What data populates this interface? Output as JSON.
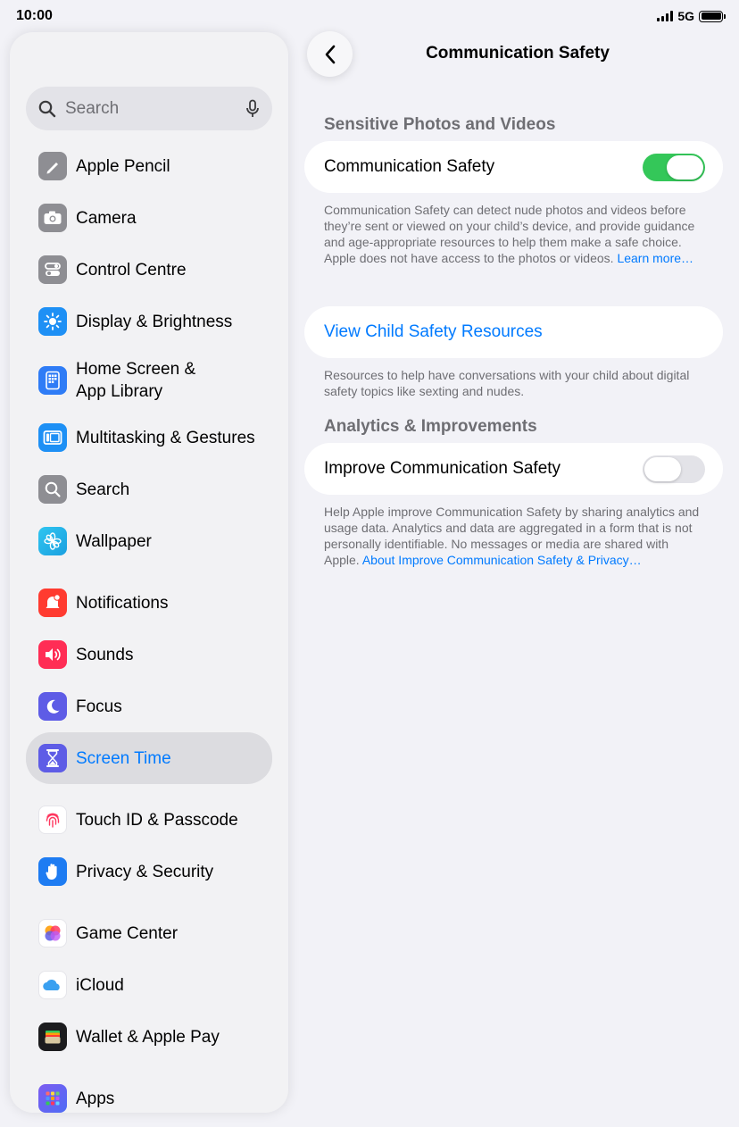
{
  "status_bar": {
    "time": "10:00",
    "network": "5G"
  },
  "sidebar": {
    "search_placeholder": "Search",
    "items": [
      {
        "label": "Apple Pencil",
        "icon": "pencil-icon",
        "color": "#8e8e93"
      },
      {
        "label": "Camera",
        "icon": "camera-icon",
        "color": "#8e8e93"
      },
      {
        "label": "Control Centre",
        "icon": "toggles-icon",
        "color": "#8e8e93"
      },
      {
        "label": "Display & Brightness",
        "icon": "sun-icon",
        "color": "#1e90f5"
      },
      {
        "label": "Home Screen &",
        "label2": "App Library",
        "icon": "home-screen-icon",
        "color": "#2f7cf6"
      },
      {
        "label": "Multitasking & Gestures",
        "icon": "multitasking-icon",
        "color": "#1e90f5"
      },
      {
        "label": "Search",
        "icon": "search-icon",
        "color": "#8e8e93"
      },
      {
        "label": "Wallpaper",
        "icon": "flower-icon",
        "color": "#1fb4e8"
      },
      {
        "label": "Notifications",
        "icon": "bell-icon",
        "color": "#ff3b30"
      },
      {
        "label": "Sounds",
        "icon": "speaker-icon",
        "color": "#ff2d55"
      },
      {
        "label": "Focus",
        "icon": "moon-icon",
        "color": "#5e5ce6"
      },
      {
        "label": "Screen Time",
        "icon": "hourglass-icon",
        "color": "#5e5ce6"
      },
      {
        "label": "Touch ID & Passcode",
        "icon": "fingerprint-icon",
        "color": "#ffffff"
      },
      {
        "label": "Privacy & Security",
        "icon": "hand-icon",
        "color": "#1e7cf2"
      },
      {
        "label": "Game Center",
        "icon": "game-center-icon",
        "color": "#ffffff"
      },
      {
        "label": "iCloud",
        "icon": "cloud-icon",
        "color": "#ffffff"
      },
      {
        "label": "Wallet & Apple Pay",
        "icon": "wallet-icon",
        "color": "#1c1c1e"
      },
      {
        "label": "Apps",
        "icon": "apps-grid-icon",
        "color": "#6c5ce7"
      }
    ],
    "selected": "Screen Time"
  },
  "detail": {
    "title": "Communication Safety",
    "section1_header": "Sensitive Photos and Videos",
    "comm_safety_label": "Communication Safety",
    "comm_safety_on": true,
    "comm_safety_footer": "Communication Safety can detect nude photos and videos before they’re sent or viewed on your child’s device, and provide guidance and age-appropriate resources to help them make a safe choice. Apple does not have access to the photos or videos.",
    "comm_safety_footer_link": "Learn more…",
    "view_resources_label": "View Child Safety Resources",
    "view_resources_footer": "Resources to help have conversations with your child about digital safety topics like sexting and nudes.",
    "section2_header": "Analytics & Improvements",
    "improve_label": "Improve Communication Safety",
    "improve_on": false,
    "improve_footer": "Help Apple improve Communication Safety by sharing analytics and usage data. Analytics and data are aggregated in a form that is not personally identifiable. No messages or media are shared with Apple.",
    "improve_footer_link": "About Improve Communication Safety & Privacy…"
  },
  "colors": {
    "accent": "#007aff",
    "toggle_on": "#34c759",
    "background": "#f2f2f7"
  }
}
